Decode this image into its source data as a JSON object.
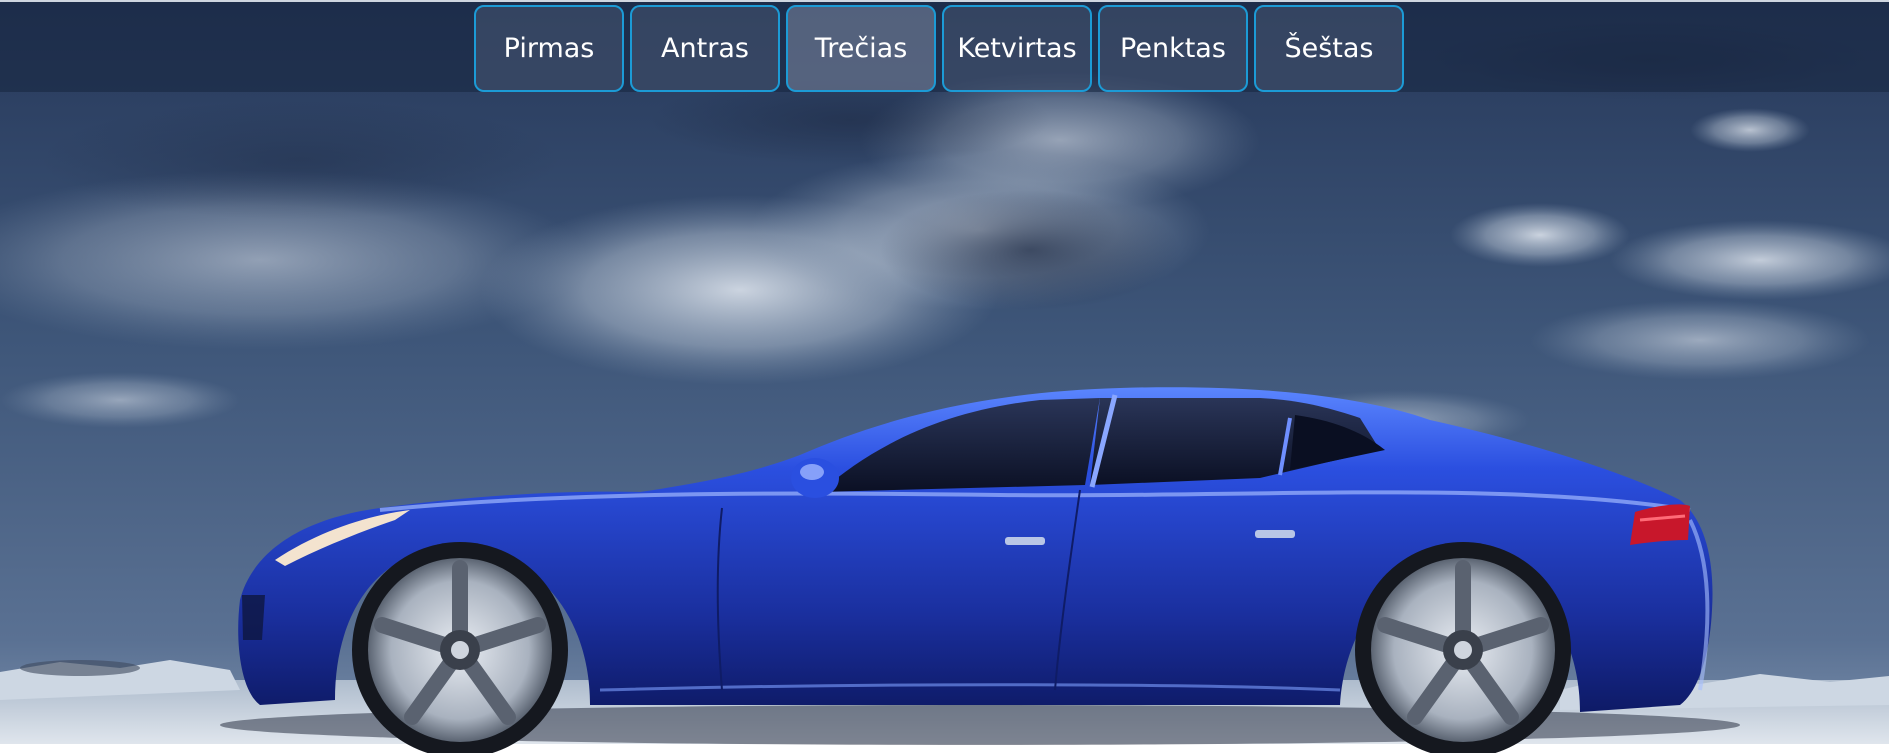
{
  "nav": {
    "items": [
      {
        "label": "Pirmas"
      },
      {
        "label": "Antras"
      },
      {
        "label": "Trečias"
      },
      {
        "label": "Ketvirtas"
      },
      {
        "label": "Penktas"
      },
      {
        "label": "Šeštas"
      }
    ],
    "active_index": 2
  },
  "hero": {
    "image": "blue-sports-car-under-cloudy-sky",
    "colors": {
      "sky_dark": "#2a3d5c",
      "sky_mid": "#4e6688",
      "cloud": "#c9d3df",
      "car_body": "#1f3fc0",
      "car_highlight": "#4f7bff",
      "ground": "#dfe6ee"
    }
  }
}
